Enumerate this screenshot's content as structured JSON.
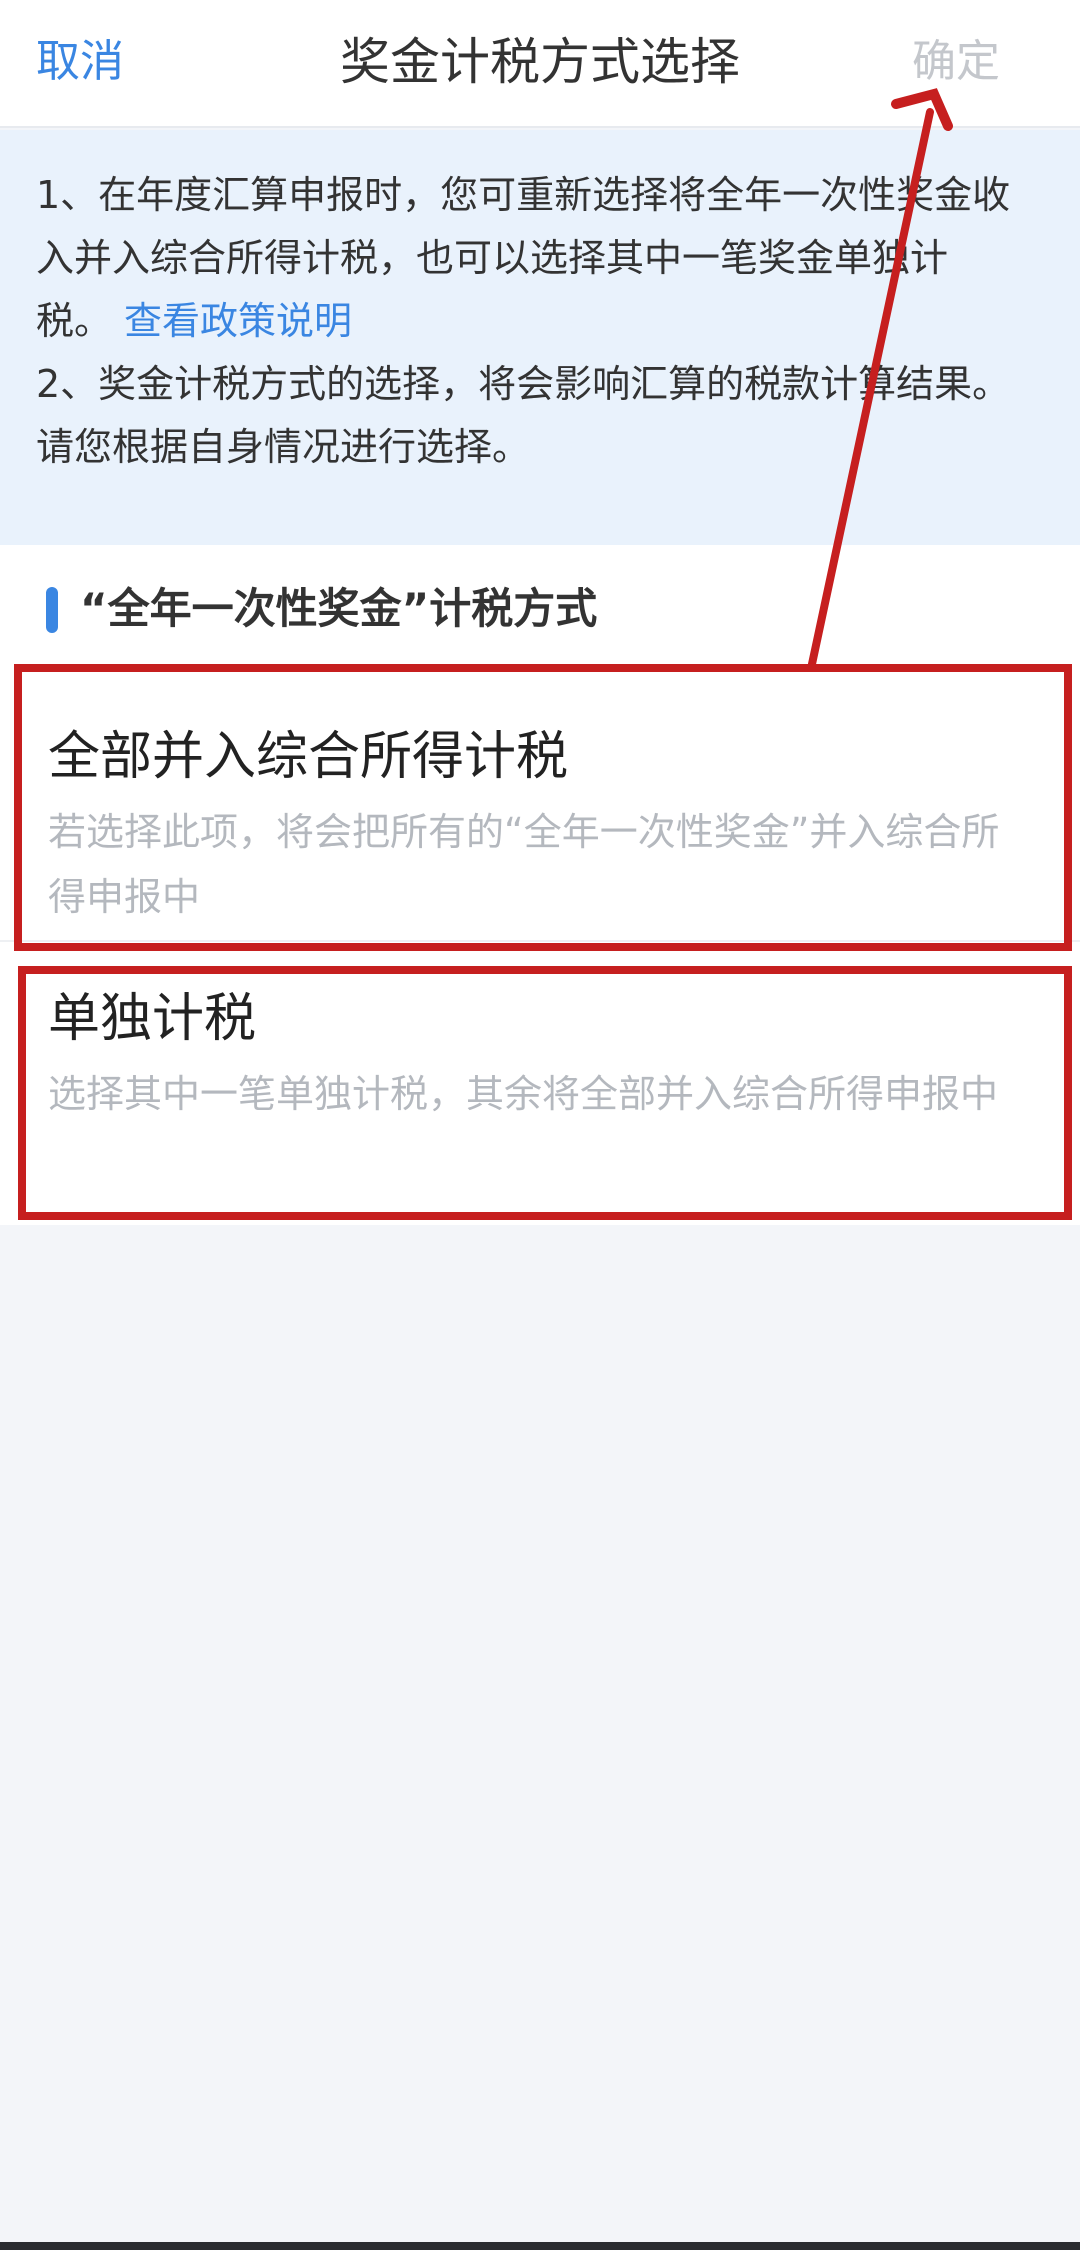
{
  "header": {
    "cancel_label": "取消",
    "title": "奖金计税方式选择",
    "confirm_label": "确定"
  },
  "notice": {
    "line1": "1、在年度汇算申报时，您可重新选择将全年一次性奖金收",
    "line2": "入并入综合所得计税，也可以选择其中一笔奖金单独计",
    "line3_prefix": "税。",
    "policy_link": "查看政策说明",
    "line4": "2、奖金计税方式的选择，将会影响汇算的税款计算结果。",
    "line5": "请您根据自身情况进行选择。"
  },
  "section": {
    "title": "“全年一次性奖金”计税方式"
  },
  "options": [
    {
      "title": "全部并入综合所得计税",
      "description": "若选择此项，将会把所有的“全年一次性奖金”并入综合所得申报中"
    },
    {
      "title": "单独计税",
      "description": "选择其中一笔单独计税，其余将全部并入综合所得申报中"
    }
  ],
  "colors": {
    "accent": "#3a86e2",
    "annotation": "#c61f1f",
    "disabled": "#c4c7cc",
    "notice_bg": "#e9f2fc"
  }
}
